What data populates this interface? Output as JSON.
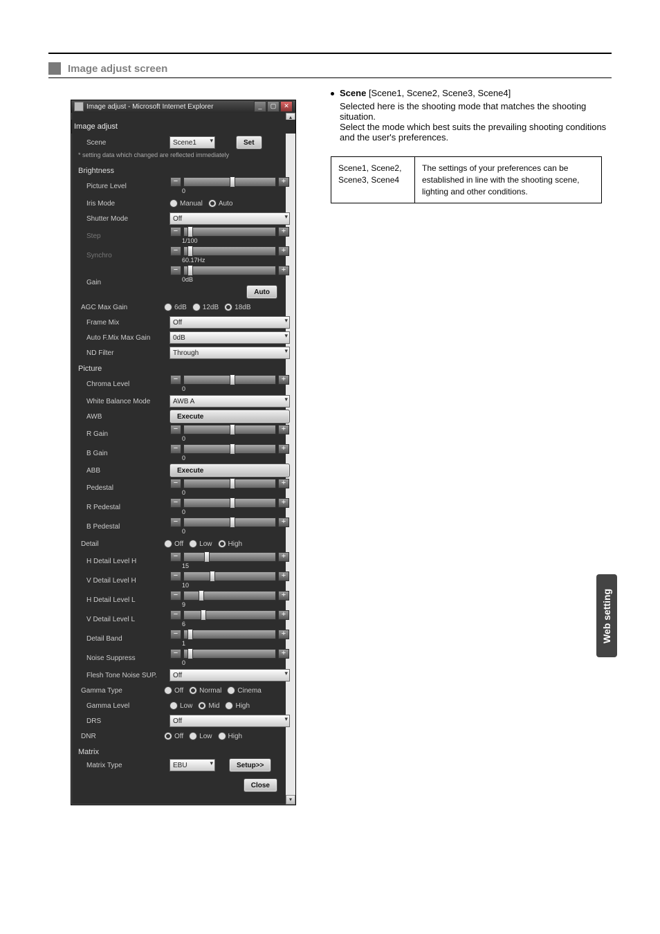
{
  "section_heading": "Image adjust screen",
  "side_tab": "Web setting",
  "titlebar": "Image adjust - Microsoft Internet Explorer",
  "panel_heading": "Image adjust",
  "note": "* setting data which changed are reflected immediately",
  "scene": {
    "label": "Scene",
    "value": "Scene1",
    "set_btn": "Set"
  },
  "groups": {
    "brightness": "Brightness",
    "picture": "Picture",
    "matrix": "Matrix"
  },
  "brightness": {
    "picture_level": {
      "label": "Picture Level",
      "value": "0",
      "pos": 50
    },
    "iris_mode": {
      "label": "Iris Mode",
      "options": [
        "Manual",
        "Auto"
      ],
      "selected": "Auto"
    },
    "shutter_mode": {
      "label": "Shutter Mode",
      "value": "Off"
    },
    "step": {
      "label": "Step",
      "value": "1/100",
      "pos": 4
    },
    "synchro": {
      "label": "Synchro",
      "value": "60.17Hz",
      "pos": 4
    },
    "gain": {
      "label": "Gain",
      "value": "0dB",
      "pos": 4,
      "auto_btn": "Auto"
    },
    "agc_max_gain": {
      "label": "AGC Max Gain",
      "options": [
        "6dB",
        "12dB",
        "18dB"
      ],
      "selected": "18dB"
    },
    "frame_mix": {
      "label": "Frame Mix",
      "value": "Off"
    },
    "auto_fmix_max_gain": {
      "label": "Auto F.Mix Max Gain",
      "value": "0dB"
    },
    "nd_filter": {
      "label": "ND Filter",
      "value": "Through"
    }
  },
  "picture": {
    "chroma_level": {
      "label": "Chroma Level",
      "value": "0",
      "pos": 50
    },
    "white_balance_mode": {
      "label": "White Balance Mode",
      "value": "AWB A"
    },
    "awb": {
      "label": "AWB",
      "btn": "Execute"
    },
    "r_gain": {
      "label": "R Gain",
      "value": "0",
      "pos": 50
    },
    "b_gain": {
      "label": "B Gain",
      "value": "0",
      "pos": 50
    },
    "abb": {
      "label": "ABB",
      "btn": "Execute"
    },
    "pedestal": {
      "label": "Pedestal",
      "value": "0",
      "pos": 50
    },
    "r_pedestal": {
      "label": "R Pedestal",
      "value": "0",
      "pos": 50
    },
    "b_pedestal": {
      "label": "B Pedestal",
      "value": "0",
      "pos": 50
    },
    "detail": {
      "label": "Detail",
      "options": [
        "Off",
        "Low",
        "High"
      ],
      "selected": "High"
    },
    "h_detail_level_h": {
      "label": "H Detail Level H",
      "value": "15",
      "pos": 22
    },
    "v_detail_level_h": {
      "label": "V Detail Level H",
      "value": "10",
      "pos": 28
    },
    "h_detail_level_l": {
      "label": "H Detail Level L",
      "value": "9",
      "pos": 16
    },
    "v_detail_level_l": {
      "label": "V Detail Level L",
      "value": "6",
      "pos": 18
    },
    "detail_band": {
      "label": "Detail Band",
      "value": "1",
      "pos": 4
    },
    "noise_suppress": {
      "label": "Noise Suppress",
      "value": "0",
      "pos": 4
    },
    "flesh_tone_noise_sup": {
      "label": "Flesh Tone Noise SUP.",
      "value": "Off"
    },
    "gamma_type": {
      "label": "Gamma Type",
      "options": [
        "Off",
        "Normal",
        "Cinema"
      ],
      "selected": "Normal"
    },
    "gamma_level": {
      "label": "Gamma Level",
      "options": [
        "Low",
        "Mid",
        "High"
      ],
      "selected": "Mid"
    },
    "drs": {
      "label": "DRS",
      "value": "Off"
    },
    "dnr": {
      "label": "DNR",
      "options": [
        "Off",
        "Low",
        "High"
      ],
      "selected": "Off"
    }
  },
  "matrix": {
    "matrix_type": {
      "label": "Matrix Type",
      "value": "EBU",
      "setup_btn": "Setup>>"
    }
  },
  "close_btn": "Close",
  "right": {
    "heading": "Scene",
    "heading_opts": "[Scene1, Scene2, Scene3, Scene4]",
    "body": "Selected here is the shooting mode that matches the shooting situation.\nSelect the mode which best suits the prevailing shooting conditions and the user's preferences.",
    "row_left": "Scene1, Scene2,\nScene3, Scene4",
    "row_right": "The settings of your preferences can be established in line with the shooting scene, lighting and other conditions."
  }
}
